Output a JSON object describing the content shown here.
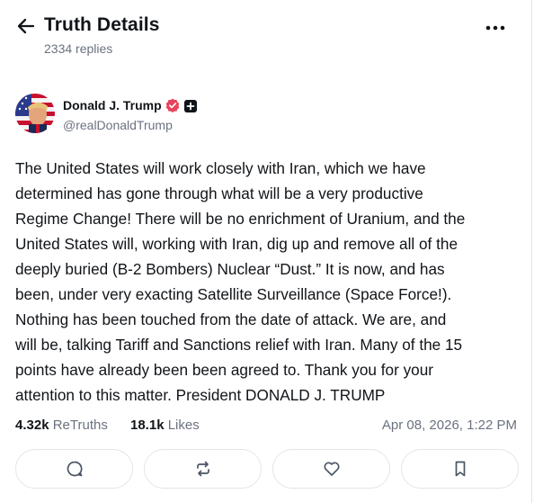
{
  "header": {
    "title": "Truth Details",
    "subtitle": "2334 replies",
    "back_icon": "arrow-left-icon",
    "more_icon": "more-horizontal-icon"
  },
  "author": {
    "name": "Donald J. Trump",
    "handle": "@realDonaldTrump",
    "verified": true,
    "verified_color": "#e8445b"
  },
  "post": {
    "text": "The United States will work closely with Iran, which we have\ndetermined has gone through what will be a very productive\nRegime Change! There will be no enrichment of Uranium, and the\nUnited States will, working with Iran, dig up and remove all of the\ndeeply buried (B-2 Bombers) Nuclear “Dust.” It is now, and has\nbeen, under very exacting Satellite Surveillance (Space Force!).\nNothing has been touched from the date of attack. We are, and\nwill be, talking Tariff and Sanctions relief with Iran. Many of the 15\npoints have already been been agreed to. Thank you for your\nattention to this matter. President DONALD J. TRUMP"
  },
  "stats": {
    "retruths_count": "4.32k",
    "retruths_label": "ReTruths",
    "likes_count": "18.1k",
    "likes_label": "Likes",
    "timestamp": "Apr 08, 2026, 1:22 PM"
  },
  "actions": [
    {
      "name": "reply",
      "icon": "comment-icon"
    },
    {
      "name": "retruth",
      "icon": "repost-icon"
    },
    {
      "name": "like",
      "icon": "heart-icon"
    },
    {
      "name": "bookmark",
      "icon": "bookmark-icon"
    }
  ],
  "colors": {
    "text": "#111418",
    "muted": "#6b7280",
    "border": "#e3e5ea"
  }
}
